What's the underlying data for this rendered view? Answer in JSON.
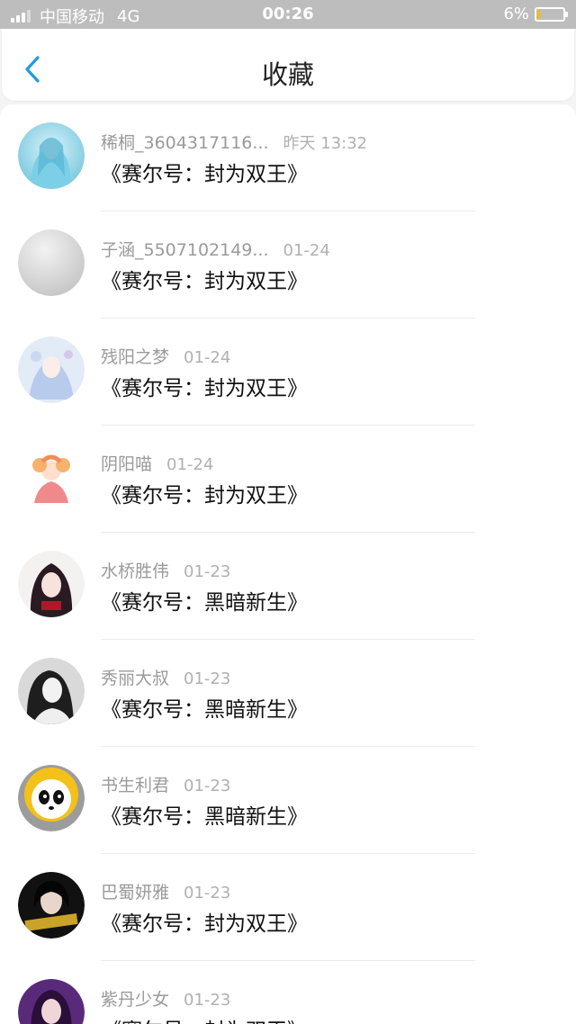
{
  "status_bar": {
    "carrier": "中国移动",
    "network": "4G",
    "time": "00:26",
    "battery": "6%",
    "battery_level": 0.06
  },
  "nav": {
    "title": "收藏",
    "back_icon": "chevron-left-icon",
    "accent_color": "#1e9be6"
  },
  "items": [
    {
      "user": "稀桐_3604317116...",
      "time": "昨天 13:32",
      "title": "《赛尔号：封为双王》"
    },
    {
      "user": "子涵_5507102149...",
      "time": "01-24",
      "title": "《赛尔号：封为双王》"
    },
    {
      "user": "残阳之梦",
      "time": "01-24",
      "title": "《赛尔号：封为双王》"
    },
    {
      "user": "阴阳喵",
      "time": "01-24",
      "title": "《赛尔号：封为双王》"
    },
    {
      "user": "水桥胜伟",
      "time": "01-23",
      "title": "《赛尔号：黑暗新生》"
    },
    {
      "user": "秀丽大叔",
      "time": "01-23",
      "title": "《赛尔号：黑暗新生》"
    },
    {
      "user": "书生利君",
      "time": "01-23",
      "title": "《赛尔号：黑暗新生》"
    },
    {
      "user": "巴蜀妍雅",
      "time": "01-23",
      "title": "《赛尔号：封为双王》"
    },
    {
      "user": "紫丹少女",
      "time": "01-23",
      "title": "《赛尔号：封为双王》"
    }
  ]
}
